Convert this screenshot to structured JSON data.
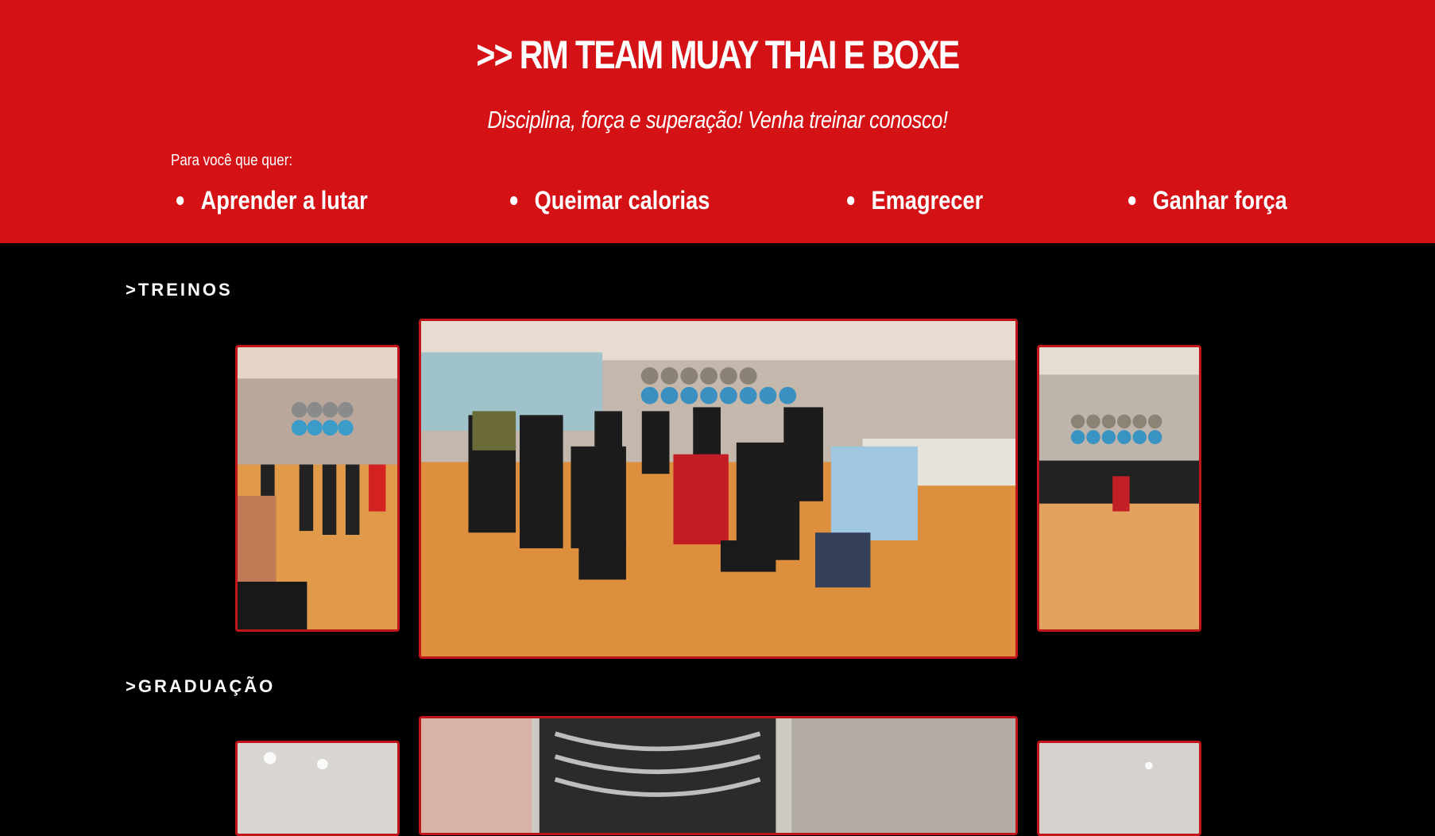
{
  "hero": {
    "title": ">> RM TEAM MUAY THAI E BOXE",
    "subtitle": "Disciplina, força e superação! Venha treinar conosco!",
    "intro": "Para você que quer:",
    "benefits": [
      "Aprender a lutar",
      "Queimar calorias",
      "Emagrecer",
      "Ganhar força"
    ]
  },
  "sections": {
    "treinos": ">TREINOS",
    "graduacao": ">GRADUAÇÃO"
  },
  "colors": {
    "brand_red": "#d41114",
    "frame_red": "#c0161a",
    "background": "#000000"
  }
}
